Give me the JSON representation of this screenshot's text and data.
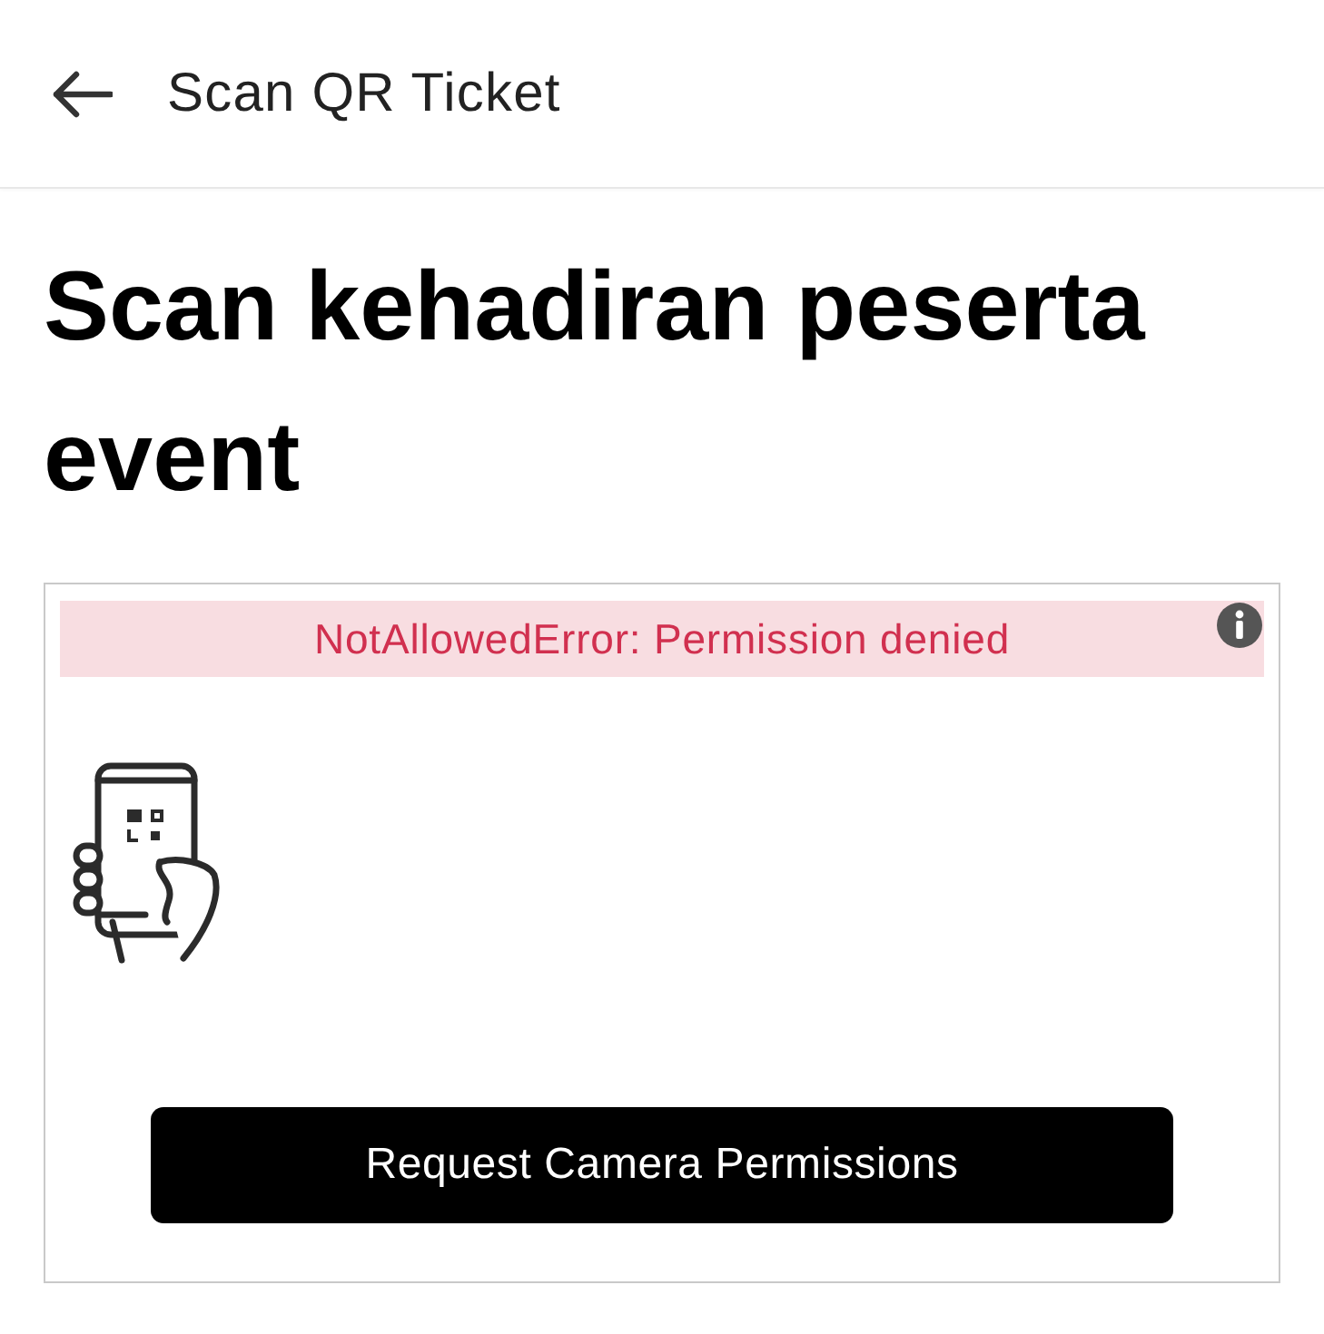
{
  "header": {
    "title": "Scan QR Ticket"
  },
  "heading": "Scan kehadiran peserta event",
  "scanner": {
    "error": "NotAllowedError: Permission denied",
    "button": "Request Camera Permissions"
  }
}
